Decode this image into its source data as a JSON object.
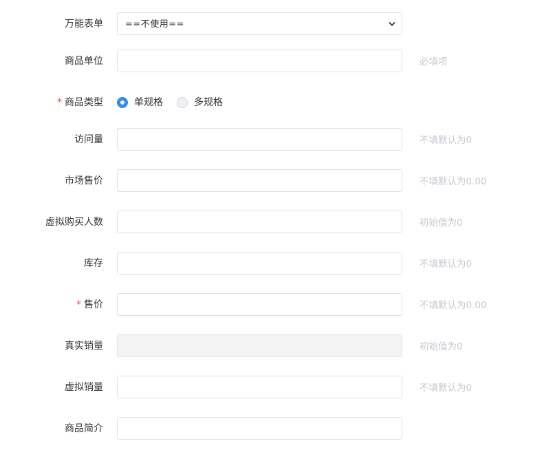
{
  "form": {
    "universal_form": {
      "label": "万能表单",
      "selected": "==不使用=="
    },
    "product_unit": {
      "label": "商品单位",
      "hint": "必填项"
    },
    "product_type": {
      "required_mark": "*",
      "label": "商品类型",
      "options": [
        {
          "label": "单规格",
          "checked": true
        },
        {
          "label": "多规格",
          "checked": false
        }
      ]
    },
    "visits": {
      "label": "访问量",
      "hint": "不填默认为0"
    },
    "market_price": {
      "label": "市场售价",
      "hint": "不填默认为0.00"
    },
    "virtual_buyers": {
      "label": "虚拟购买人数",
      "hint": "初始值为0"
    },
    "stock": {
      "label": "库存",
      "hint": "不填默认为0"
    },
    "price": {
      "required_mark": "*",
      "label": "售价",
      "hint": "不填默认为0.00"
    },
    "real_sales": {
      "label": "真实销量",
      "hint": "初始值为0"
    },
    "virtual_sales": {
      "label": "虚拟销量",
      "hint": "不填默认为0"
    },
    "product_intro": {
      "label": "商品简介"
    }
  }
}
